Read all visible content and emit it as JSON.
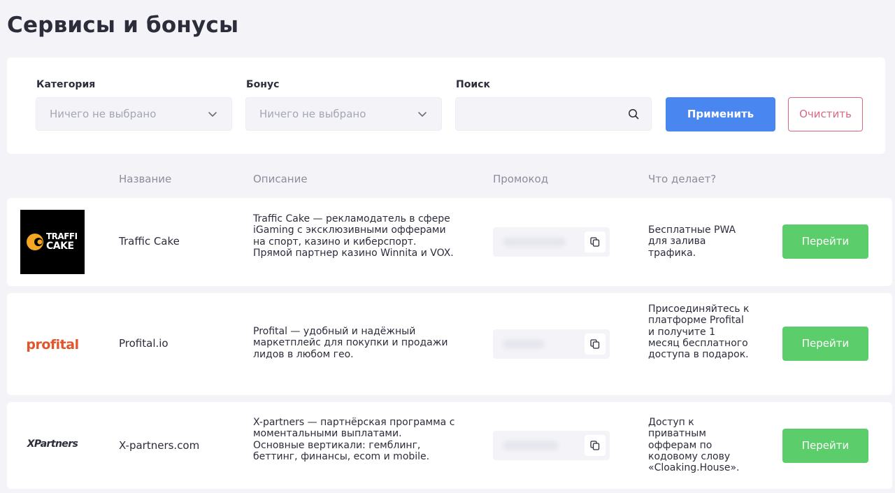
{
  "page": {
    "title": "Сервисы и бонусы"
  },
  "filters": {
    "category": {
      "label": "Категория",
      "value": "Ничего не выбрано"
    },
    "bonus": {
      "label": "Бонус",
      "value": "Ничего не выбрано"
    },
    "search": {
      "label": "Поиск",
      "value": ""
    },
    "apply_label": "Применить",
    "clear_label": "Очистить"
  },
  "table": {
    "headers": [
      "Название",
      "Описание",
      "Промокод",
      "Что делает?"
    ],
    "rows": [
      {
        "logo_text": [
          "TRAFFI",
          "CAKE"
        ],
        "name": "Traffic Cake",
        "description": "Traffic Cake — рекламодатель в сфере iGaming с эксклюзивными офферами на спорт, казино и киберспорт. Прямой партнер казино Winnita и VOX.",
        "what": "Бесплатные PWA для залива трафика.",
        "action": "Перейти"
      },
      {
        "logo_text": "profital",
        "name": "Profital.io",
        "description": "Profital — удобный и надёжный маркетплейс для покупки и продажи лидов в любом гео.",
        "what": "Присоединяйтесь к платформе Profital и получите 1 месяц бесплатного доступа в подарок.",
        "action": "Перейти"
      },
      {
        "logo_text": "XPartners",
        "name": "X-partners.com",
        "description": "X-partners — партнёрская программа с моментальными выплатами. Основные вертикали: гемблинг, беттинг, финансы, ecom и mobile.",
        "what": "Доступ к приватным офферам по кодовому слову «Cloaking.House».",
        "action": "Перейти"
      }
    ]
  },
  "icons": {
    "dropdown": "chevron-down-icon",
    "search": "search-icon",
    "copy": "copy-icon"
  },
  "colors": {
    "primary": "#4a86f0",
    "danger": "#d9687e",
    "success": "#5ccd6b",
    "background": "#f3f3f8"
  }
}
